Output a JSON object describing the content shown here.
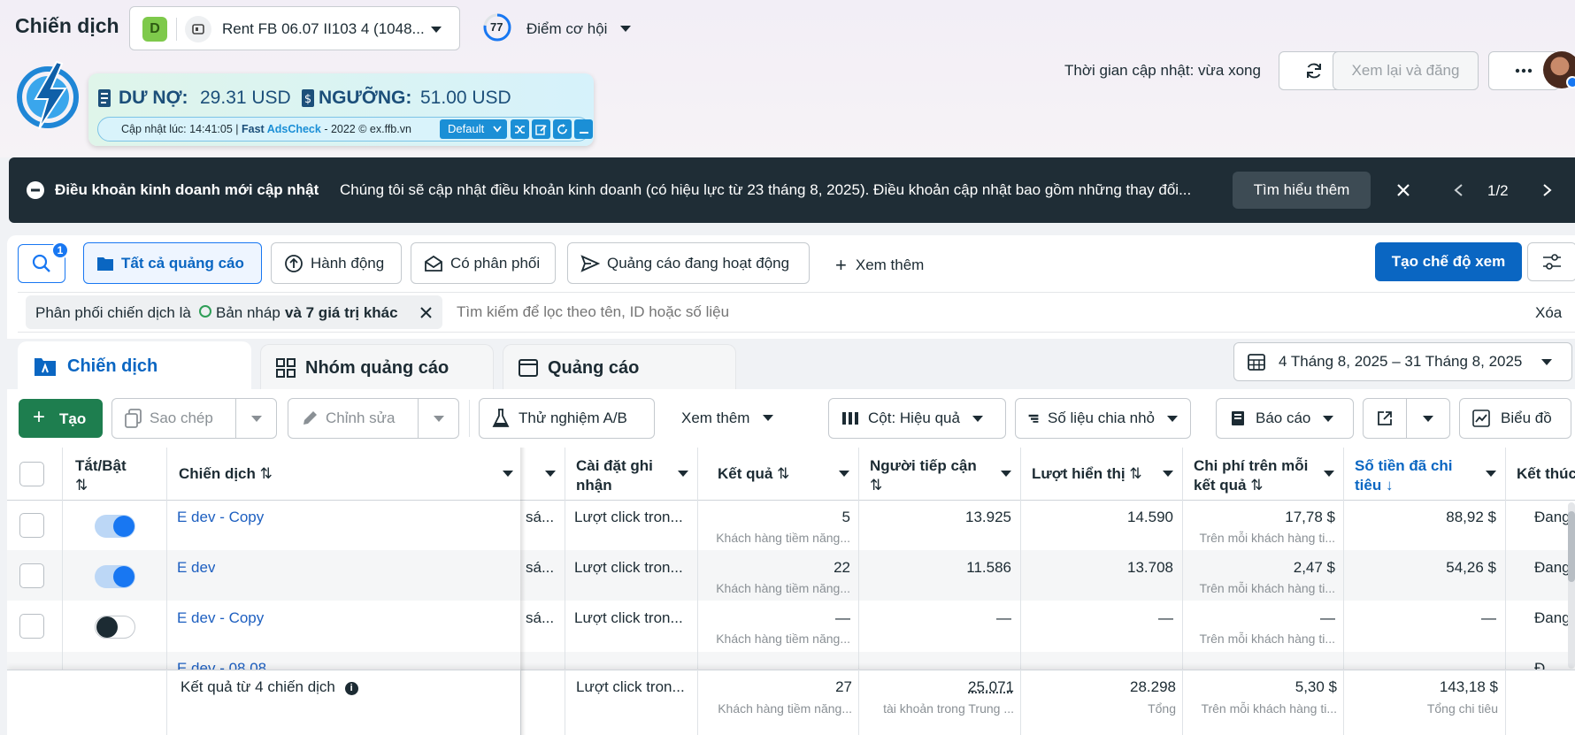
{
  "header": {
    "page_title": "Chiến dịch",
    "account_badge": "D",
    "account_name": "Rent FB 06.07 II103 4 (1048...",
    "score_value": "77",
    "score_label": "Điểm cơ hội",
    "update_time": "Thời gian cập nhật: vừa xong",
    "review_publish": "Xem lại và đăng"
  },
  "adscheck": {
    "debt_label": "DƯ NỢ:",
    "debt_value": "29.31 USD",
    "threshold_label": "NGƯỠNG:",
    "threshold_value": "51.00 USD",
    "updated_at": "Cập nhật lúc: 14:41:05 | ",
    "brand_fast": "Fast ",
    "brand_adscheck": "AdsCheck",
    "copyright": " - 2022 © ex.ffb.vn",
    "profile_select": "Default"
  },
  "banner": {
    "title": "Điều khoản kinh doanh mới cập nhật",
    "message": "Chúng tôi sẽ cập nhật điều khoản kinh doanh (có hiệu lực từ 23 tháng 8, 2025). Điều khoản cập nhật bao gồm những thay đổi...",
    "learn_more": "Tìm hiểu thêm",
    "pager": "1/2"
  },
  "filters": {
    "search_badge": "1",
    "chips": [
      "Tất cả quảng cáo",
      "Hành động",
      "Có phân phối",
      "Quảng cáo đang hoạt động"
    ],
    "more": "Xem thêm",
    "create_view": "Tạo chế độ xem",
    "active_filter_prefix": "Phân phối chiến dịch là",
    "active_filter_value": "Bản nháp",
    "active_filter_more": "và 7 giá trị khác",
    "search_placeholder": "Tìm kiếm để lọc theo tên, ID hoặc số liệu",
    "clear": "Xóa"
  },
  "tabs": {
    "campaign": "Chiến dịch",
    "adset": "Nhóm quảng cáo",
    "ad": "Quảng cáo",
    "date_range": "4 Tháng 8, 2025 – 31 Tháng 8, 2025"
  },
  "toolbar": {
    "create": "Tạo",
    "duplicate": "Sao chép",
    "edit": "Chỉnh sửa",
    "ab_test": "Thử nghiệm A/B",
    "more": "Xem thêm",
    "columns": "Cột: Hiệu quả",
    "breakdown": "Số liệu chia nhỏ",
    "reports": "Báo cáo",
    "chart": "Biểu đồ"
  },
  "table": {
    "headers": {
      "toggle": "Tắt/Bật",
      "campaign": "Chiến dịch",
      "attribution": "Cài đặt ghi nhận",
      "results": "Kết quả",
      "reach": "Người tiếp cận",
      "impressions": "Lượt hiển thị",
      "cost_per_result": "Chi phí trên mỗi kết quả",
      "amount_spent": "Số tiền đã chi tiêu",
      "ends": "Kết thúc"
    },
    "rows": [
      {
        "name": "E dev - Copy",
        "trunc": "sá...",
        "attribution": "Lượt click tron...",
        "results": "5",
        "results_sub": "Khách hàng tiềm năng...",
        "reach": "13.925",
        "impressions": "14.590",
        "cpr": "17,78 $",
        "cpr_sub": "Trên mỗi khách hàng ti...",
        "spent": "88,92 $",
        "ends": "Đang",
        "on": true
      },
      {
        "name": "E dev",
        "trunc": "sá...",
        "attribution": "Lượt click tron...",
        "results": "22",
        "results_sub": "Khách hàng tiềm năng...",
        "reach": "11.586",
        "impressions": "13.708",
        "cpr": "2,47 $",
        "cpr_sub": "Trên mỗi khách hàng ti...",
        "spent": "54,26 $",
        "ends": "Đang",
        "on": true
      },
      {
        "name": "E dev - Copy",
        "trunc": "sá...",
        "attribution": "Lượt click tron...",
        "results": "—",
        "results_sub": "Khách hàng tiềm năng...",
        "reach": "—",
        "impressions": "—",
        "cpr": "—",
        "cpr_sub": "Trên mỗi khách hàng ti...",
        "spent": "—",
        "ends": "Đang",
        "on": false
      }
    ],
    "partial_row": {
      "name": "E dev - 08.08",
      "ends": "Đ"
    },
    "summary": {
      "label": "Kết quả từ 4 chiến dịch",
      "attribution": "Lượt click tron...",
      "results": "27",
      "results_sub": "Khách hàng tiềm năng...",
      "reach": "25.071",
      "reach_sub": "tài khoản trong Trung ...",
      "impressions": "28.298",
      "impressions_sub": "Tổng",
      "cpr": "5,30 $",
      "cpr_sub": "Trên mỗi khách hàng ti...",
      "spent": "143,18 $",
      "spent_sub": "Tổng chi tiêu"
    }
  },
  "colors": {
    "accent": "#0a66c2",
    "create_green": "#1e7e4f",
    "banner_bg": "#1f2d36",
    "toggle_on": "#1877f2"
  }
}
